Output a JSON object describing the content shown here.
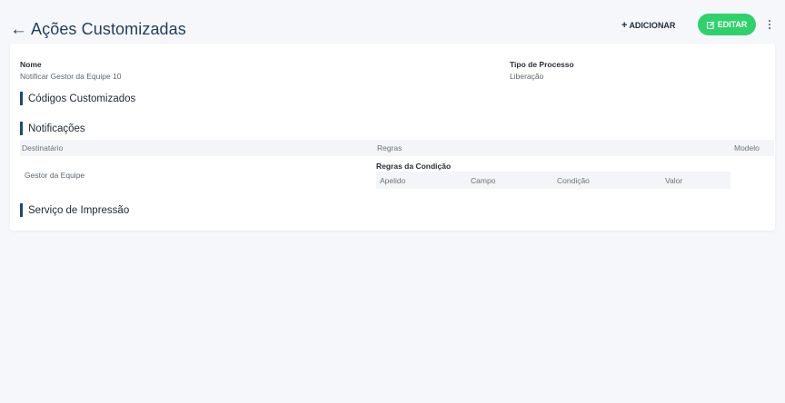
{
  "header": {
    "back_icon": "arrow-left-icon",
    "title": "Ações Customizadas",
    "add_label": "ADICIONAR",
    "add_icon": "plus-icon",
    "edit_label": "EDITAR",
    "edit_icon": "edit-icon",
    "more_icon": "more-vertical-icon",
    "accent_color": "#2fd16b"
  },
  "details": {
    "nome_label": "Nome",
    "nome_value": "Notificar Gestor da Equipe 10",
    "tipo_label": "Tipo de Processo",
    "tipo_value": "Liberação"
  },
  "sections": {
    "codigos": "Códigos Customizados",
    "notificacoes": "Notificações",
    "servico": "Serviço de Impressão"
  },
  "notifications_table": {
    "columns": [
      "Destinatário",
      "Regras",
      "Modelo"
    ],
    "rows": [
      {
        "destinatario": "Gestor da Equipe",
        "regras_title": "Regras da Condição",
        "regras_columns": [
          "Apelido",
          "Campo",
          "Condição",
          "Valor"
        ]
      }
    ]
  }
}
